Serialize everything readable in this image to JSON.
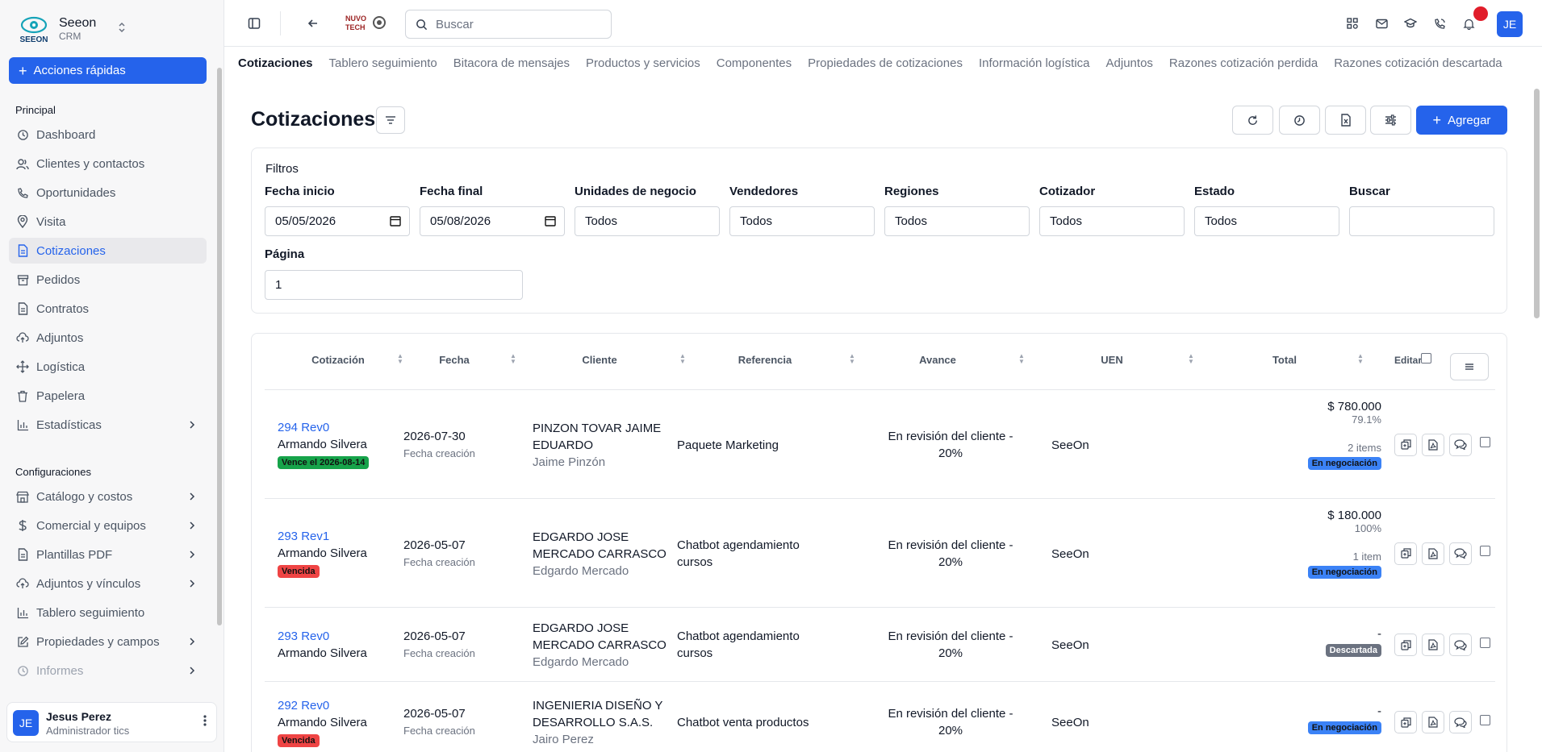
{
  "brand": {
    "name": "Seeon",
    "sub": "CRM"
  },
  "quick_actions": "Acciones rápidas",
  "sections": {
    "principal": "Principal",
    "config": "Configuraciones"
  },
  "nav_principal": [
    {
      "label": "Dashboard",
      "icon": "clock-icon"
    },
    {
      "label": "Clientes y contactos",
      "icon": "users-icon"
    },
    {
      "label": "Oportunidades",
      "icon": "phone-icon"
    },
    {
      "label": "Visita",
      "icon": "map-pin-icon"
    },
    {
      "label": "Cotizaciones",
      "icon": "file-icon",
      "active": true
    },
    {
      "label": "Pedidos",
      "icon": "box-icon"
    },
    {
      "label": "Contratos",
      "icon": "file-icon"
    },
    {
      "label": "Adjuntos",
      "icon": "cloud-icon"
    },
    {
      "label": "Logística",
      "icon": "move-icon"
    },
    {
      "label": "Papelera",
      "icon": "trash-icon"
    },
    {
      "label": "Estadísticas",
      "icon": "chart-icon",
      "chevron": true
    }
  ],
  "nav_config": [
    {
      "label": "Catálogo y costos",
      "icon": "store-icon",
      "chevron": true
    },
    {
      "label": "Comercial y equipos",
      "icon": "dollar-icon",
      "chevron": true
    },
    {
      "label": "Plantillas PDF",
      "icon": "file-icon",
      "chevron": true
    },
    {
      "label": "Adjuntos y vínculos",
      "icon": "cloud-icon",
      "chevron": true
    },
    {
      "label": "Tablero seguimiento",
      "icon": "chart-icon"
    },
    {
      "label": "Propiedades y campos",
      "icon": "edit-icon",
      "chevron": true
    },
    {
      "label": "Informes",
      "icon": "clock-icon",
      "chevron": true
    }
  ],
  "user": {
    "initials": "JE",
    "name": "Jesus Perez",
    "role": "Administrador tics"
  },
  "topbar": {
    "search_placeholder": "Buscar",
    "company": "NUVO TECH",
    "avatar": "JE"
  },
  "tabs": [
    "Cotizaciones",
    "Tablero seguimiento",
    "Bitacora de mensajes",
    "Productos y servicios",
    "Componentes",
    "Propiedades de cotizaciones",
    "Información logística",
    "Adjuntos",
    "Razones cotización perdida",
    "Razones cotización descartada"
  ],
  "page": {
    "title": "Cotizaciones",
    "add_label": "Agregar"
  },
  "filters": {
    "title": "Filtros",
    "fecha_inicio": {
      "label": "Fecha inicio",
      "value": "05/05/2026"
    },
    "fecha_final": {
      "label": "Fecha final",
      "value": "05/08/2026"
    },
    "unidades": {
      "label": "Unidades de negocio",
      "value": "Todos"
    },
    "vendedores": {
      "label": "Vendedores",
      "value": "Todos"
    },
    "regiones": {
      "label": "Regiones",
      "value": "Todos"
    },
    "cotizador": {
      "label": "Cotizador",
      "value": "Todos"
    },
    "estado": {
      "label": "Estado",
      "value": "Todos"
    },
    "buscar": {
      "label": "Buscar",
      "value": ""
    },
    "pagina": {
      "label": "Página",
      "value": "1"
    }
  },
  "table": {
    "headers": [
      "Cotización",
      "Fecha",
      "Cliente",
      "Referencia",
      "Avance",
      "UEN",
      "Total",
      "Editar"
    ],
    "rows": [
      {
        "quote": "294 Rev0",
        "seller": "Armando Silvera",
        "badge": "Vence el 2026-08-14",
        "badge_type": "green",
        "date": "2026-07-30",
        "date_sub": "Fecha creación",
        "client1": "PINZON TOVAR JAIME",
        "client2": "EDUARDO",
        "contact": "Jaime Pinzón",
        "ref1": "Paquete Marketing",
        "ref2": "",
        "progress1": "En revisión del cliente -",
        "progress2": "20%",
        "uen": "SeeOn",
        "amount": "$ 780.000",
        "pct": "79.1%",
        "items": "2 items",
        "status": "En negociación",
        "status_type": "blue"
      },
      {
        "quote": "293 Rev1",
        "seller": "Armando Silvera",
        "badge": "Vencida",
        "badge_type": "red",
        "date": "2026-05-07",
        "date_sub": "Fecha creación",
        "client1": "EDGARDO JOSE",
        "client2": "MERCADO CARRASCO",
        "contact": "Edgardo Mercado",
        "ref1": "Chatbot agendamiento",
        "ref2": "cursos",
        "progress1": "En revisión del cliente -",
        "progress2": "20%",
        "uen": "SeeOn",
        "amount": "$ 180.000",
        "pct": "100%",
        "items": "1 item",
        "status": "En negociación",
        "status_type": "blue"
      },
      {
        "quote": "293 Rev0",
        "seller": "Armando Silvera",
        "badge": "",
        "badge_type": "",
        "date": "2026-05-07",
        "date_sub": "Fecha creación",
        "client1": "EDGARDO JOSE",
        "client2": "MERCADO CARRASCO",
        "contact": "Edgardo Mercado",
        "ref1": "Chatbot agendamiento",
        "ref2": "cursos",
        "progress1": "En revisión del cliente -",
        "progress2": "20%",
        "uen": "SeeOn",
        "amount": "-",
        "pct": "",
        "items": "",
        "status": "Descartada",
        "status_type": "gray"
      },
      {
        "quote": "292 Rev0",
        "seller": "Armando Silvera",
        "badge": "Vencida",
        "badge_type": "red",
        "date": "2026-05-07",
        "date_sub": "Fecha creación",
        "client1": "INGENIERIA DISEÑO Y",
        "client2": "DESARROLLO S.A.S.",
        "contact": "Jairo Perez",
        "ref1": "Chatbot venta productos",
        "ref2": "",
        "progress1": "En revisión del cliente -",
        "progress2": "20%",
        "uen": "SeeOn",
        "amount": "-",
        "pct": "",
        "items": "",
        "status": "En negociación",
        "status_type": "blue"
      }
    ]
  },
  "colors": {
    "accent": "#2563eb",
    "notification": "#e11d2a"
  }
}
